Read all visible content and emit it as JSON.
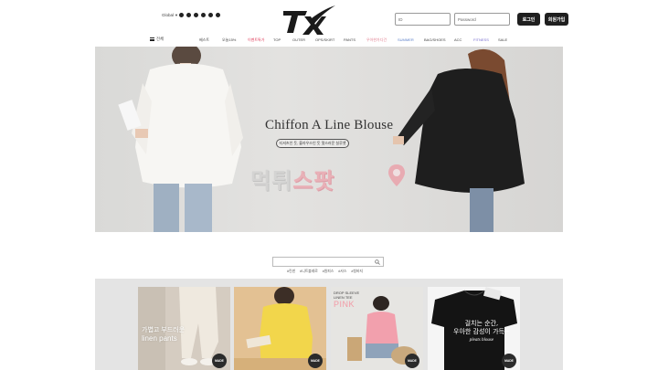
{
  "header": {
    "lang": "Global",
    "social_icons": [
      "twitter-icon",
      "pinterest-icon",
      "facebook-icon",
      "instagram-icon",
      "blog-icon",
      "youtube-icon"
    ],
    "logo_text": "TX",
    "login": {
      "id_placeholder": "ID",
      "pw_placeholder": "Password",
      "login_label": "로그인",
      "join_label": "회원가입"
    }
  },
  "nav": {
    "all_label": "전체",
    "items": [
      {
        "label": "베스트",
        "color": "#444444"
      },
      {
        "label": "오늘15%",
        "color": "#444444"
      },
      {
        "label": "이벤트특가",
        "color": "#e03c5a"
      },
      {
        "label": "TOP",
        "color": "#444444"
      },
      {
        "label": "OUTER",
        "color": "#444444"
      },
      {
        "label": "OPS/SKIRT",
        "color": "#444444"
      },
      {
        "label": "PANTS",
        "color": "#444444"
      },
      {
        "label": "우아한가디건",
        "color": "#e07a8c"
      },
      {
        "label": "SUMMER",
        "color": "#5b7fc9"
      },
      {
        "label": "BAG/SHOES",
        "color": "#444444"
      },
      {
        "label": "ACC",
        "color": "#444444"
      },
      {
        "label": "FITNESS",
        "color": "#7a6fd0"
      },
      {
        "label": "SALE",
        "color": "#444444"
      }
    ]
  },
  "banner": {
    "title": "Chiffon A Line Blouse",
    "subtitle": "티셔츠인 듯, 블라우스인 듯 멋스러운 실루엣",
    "watermark_part1": "먹튀",
    "watermark_part2": "스팟"
  },
  "search": {
    "placeholder": "",
    "tags": [
      "#린넨",
      "#니트볼레로",
      "#원피스",
      "#샤스",
      "#청바지"
    ]
  },
  "products": [
    {
      "line1": "가볍고 부드러운",
      "line2": "linen pants",
      "badge": "MADE"
    },
    {
      "badge": "MADE"
    },
    {
      "line1": "DROP SLEEVE",
      "line2": "LINEN TEE",
      "line3": "PINK",
      "badge": "MADE"
    },
    {
      "line1": "걸치는 순간,",
      "line2": "우아한 감성이 가득~",
      "line3": "pleats blouse",
      "badge": "MADE"
    }
  ],
  "colors": {
    "accent_dark": "#1f1f1f",
    "banner_bg": "#dedddb",
    "band_bg": "#e4e4e4"
  }
}
